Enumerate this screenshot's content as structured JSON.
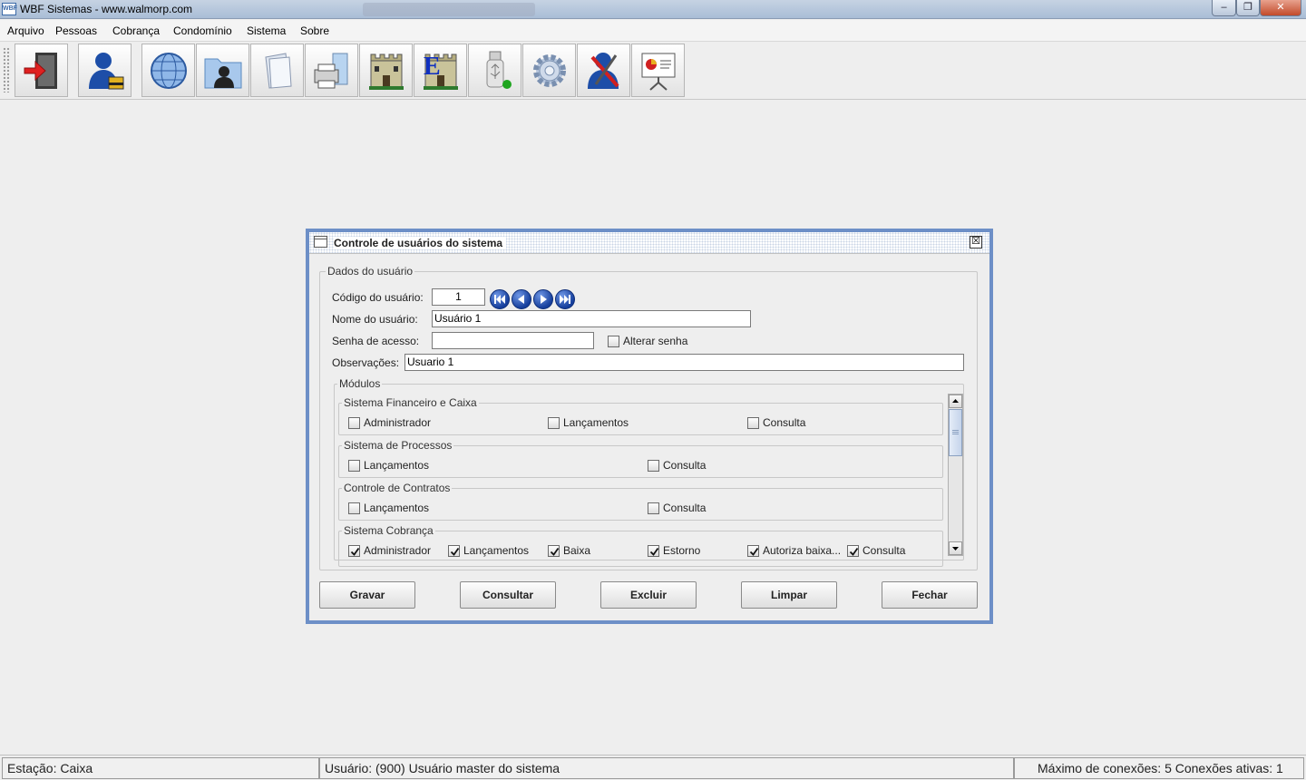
{
  "window": {
    "title": "WBF Sistemas - www.walmorp.com",
    "app_icon_text": "WBF",
    "controls": {
      "minimize": "–",
      "maximize": "❐",
      "close": "✕"
    }
  },
  "menu": [
    "Arquivo",
    "Pessoas",
    "Cobrança",
    "Condomínio",
    "Sistema",
    "Sobre"
  ],
  "toolbar": {
    "buttons": [
      {
        "name": "exit-icon"
      },
      {
        "name": "user-lock-icon"
      },
      {
        "name": "globe-icon"
      },
      {
        "name": "contacts-folder-icon"
      },
      {
        "name": "documents-icon"
      },
      {
        "name": "printer-icon"
      },
      {
        "name": "building-icon"
      },
      {
        "name": "building-e-icon",
        "letter": "E"
      },
      {
        "name": "usb-drive-icon"
      },
      {
        "name": "settings-gear-icon"
      },
      {
        "name": "user-tools-icon"
      },
      {
        "name": "presentation-icon"
      }
    ]
  },
  "dialog": {
    "title": "Controle de usuários do sistema",
    "close_glyph": "☒",
    "group_title": "Dados do usuário",
    "labels": {
      "codigo": "Código do usuário:",
      "nome": "Nome do usuário:",
      "senha": "Senha de acesso:",
      "obs": "Observações:"
    },
    "values": {
      "codigo": "1",
      "nome": "Usuário 1",
      "senha": "",
      "obs": "Usuario 1"
    },
    "alterar_senha": {
      "label": "Alterar senha",
      "checked": false
    },
    "modules_title": "Módulos",
    "modules": [
      {
        "title": "Sistema Financeiro e Caixa",
        "items": [
          {
            "label": "Administrador",
            "checked": false
          },
          {
            "label": "Lançamentos",
            "checked": false
          },
          {
            "label": "Consulta",
            "checked": false
          }
        ]
      },
      {
        "title": "Sistema de Processos",
        "items": [
          {
            "label": "Lançamentos",
            "checked": false
          },
          {
            "label": "Consulta",
            "checked": false
          }
        ]
      },
      {
        "title": "Controle de Contratos",
        "items": [
          {
            "label": "Lançamentos",
            "checked": false
          },
          {
            "label": "Consulta",
            "checked": false
          }
        ]
      },
      {
        "title": "Sistema Cobrança",
        "items": [
          {
            "label": "Administrador",
            "checked": true
          },
          {
            "label": "Lançamentos",
            "checked": true
          },
          {
            "label": "Baixa",
            "checked": true
          },
          {
            "label": "Estorno",
            "checked": true
          },
          {
            "label": "Autoriza baixa...",
            "checked": true
          },
          {
            "label": "Consulta",
            "checked": true
          }
        ]
      }
    ],
    "buttons": [
      "Gravar",
      "Consultar",
      "Excluir",
      "Limpar",
      "Fechar"
    ]
  },
  "status": {
    "estacao": "Estação: Caixa",
    "usuario": "Usuário: (900) Usuário master do sistema",
    "conexoes": "Máximo de conexões: 5 Conexões ativas: 1"
  }
}
